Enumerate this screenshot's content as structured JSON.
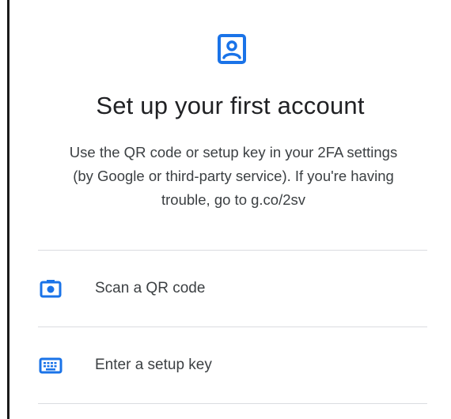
{
  "header": {
    "icon": "account-portrait-icon",
    "title": "Set up your first account"
  },
  "description": {
    "lines": [
      "Use the QR code or setup key in your 2FA settings",
      "(by Google or third-party service). If you're having",
      "trouble, go to g.co/2sv"
    ]
  },
  "options": [
    {
      "icon": "camera-icon",
      "label": "Scan a QR code"
    },
    {
      "icon": "keyboard-icon",
      "label": "Enter a setup key"
    }
  ],
  "colors": {
    "accent": "#1a73e8",
    "title_text": "#202124",
    "body_text": "#3c4043",
    "divider": "#dadce0"
  }
}
